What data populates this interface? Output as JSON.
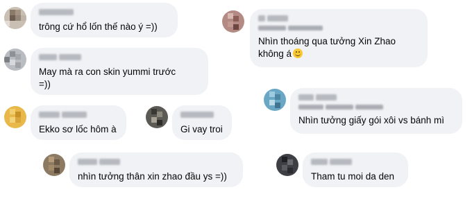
{
  "comments": [
    {
      "id": "c1",
      "text": "trông cứ hổ lốn thế nào ý =))"
    },
    {
      "id": "c2",
      "text": "May mà ra con skin yummi trước\n=))"
    },
    {
      "id": "c3",
      "text": "Ekko sơ lốc hôm à"
    },
    {
      "id": "c4",
      "text": "Gi vay troi"
    },
    {
      "id": "c5",
      "text": "nhìn tưởng thân xin zhao đầu ys =))"
    },
    {
      "id": "c6",
      "text": "Nhìn thoáng qua tưởng Xin Zhao\nkhông á",
      "emoji": "slightly-smiling-face-icon"
    },
    {
      "id": "c7",
      "text": "Nhìn tưởng giấy gói xôi vs bánh mì"
    },
    {
      "id": "c8",
      "text": "Tham tu moi da den"
    }
  ],
  "colors": {
    "bubble": "#f0f2f5",
    "text": "#050505",
    "blurred_name": "#b6bac0"
  }
}
